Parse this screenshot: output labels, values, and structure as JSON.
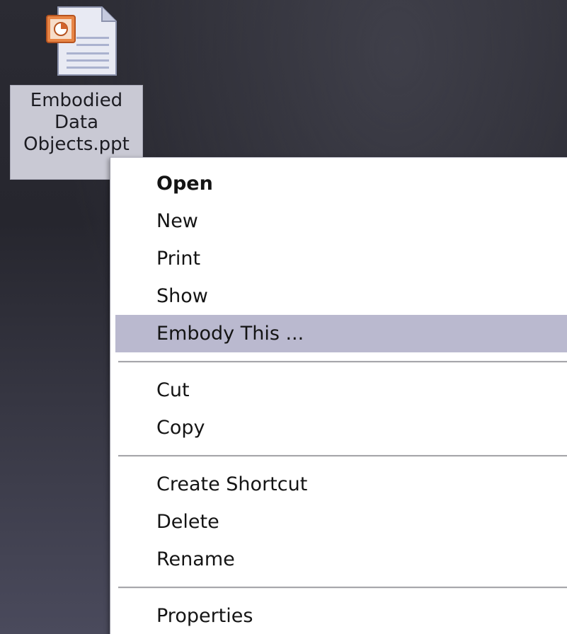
{
  "desktop": {
    "icon": {
      "name": "Embodied Data Objects.ppt",
      "icon_type": "powerpoint-file-icon"
    }
  },
  "context_menu": {
    "group1": [
      {
        "label": "Open",
        "default": true
      },
      {
        "label": "New"
      },
      {
        "label": "Print"
      },
      {
        "label": "Show"
      },
      {
        "label": "Embody This ...",
        "highlighted": true
      }
    ],
    "group2": [
      {
        "label": "Cut"
      },
      {
        "label": "Copy"
      }
    ],
    "group3": [
      {
        "label": "Create Shortcut"
      },
      {
        "label": "Delete"
      },
      {
        "label": "Rename"
      }
    ],
    "group4": [
      {
        "label": "Properties"
      }
    ]
  },
  "colors": {
    "desktop_bg": "#2b2b33",
    "caption_selected_bg": "#c9c9d4",
    "menu_bg": "#ffffff",
    "menu_highlight": "#bab9cf",
    "separator": "#a7a7ab"
  }
}
